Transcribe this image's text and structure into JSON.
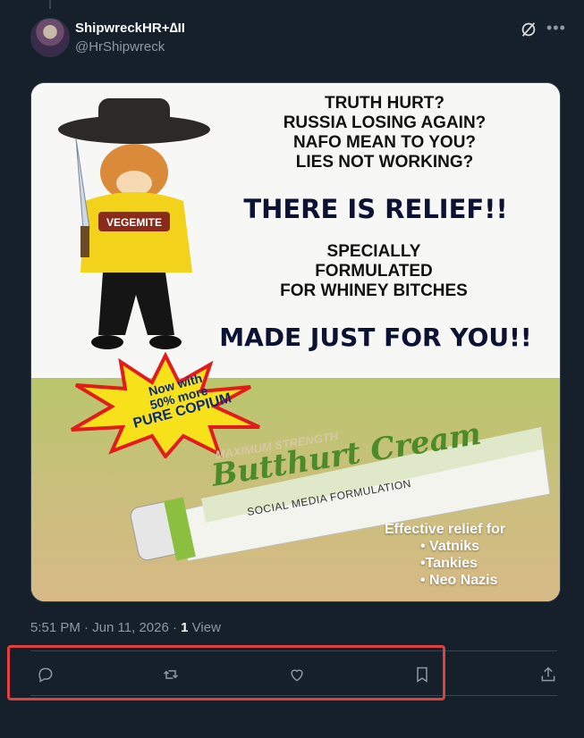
{
  "post": {
    "author_name": "ShipwreckHR+∆II",
    "author_handle": "@HrShipwreck",
    "timestamp": "5:51 PM · Jun 11, 2026 · ",
    "views_count": "1",
    "views_label": " View"
  },
  "image_text": {
    "questions": [
      "TRUTH HURT?",
      "RUSSIA LOSING AGAIN?",
      "NAFO MEAN TO YOU?",
      "LIES NOT WORKING?"
    ],
    "relief": "THERE IS RELIEF!!",
    "special": [
      "SPECIALLY",
      "FORMULATED",
      "FOR WHINEY BITCHES"
    ],
    "made": "MADE JUST FOR YOU!!",
    "badge": [
      "Now with",
      "50% more",
      "PURE COPIUM"
    ],
    "hoodie": "VEGEMITE",
    "tube_strength": "MAXIMUM STRENGTH",
    "tube_brand": "Butthurt Cream",
    "tube_sub": "SOCIAL MEDIA FORMULATION",
    "effective_title": "Effective relief for",
    "effective_items": [
      "• Vatniks",
      "•Tankies",
      "• Neo Nazis"
    ]
  },
  "icons": {
    "reply": "reply-icon",
    "repost": "repost-icon",
    "like": "like-icon",
    "bookmark": "bookmark-icon",
    "share": "share-icon",
    "grok": "grok-icon",
    "more": "more-icon"
  },
  "colors": {
    "background": "#15202b",
    "muted": "#8b98a5",
    "highlight": "#e0403f"
  }
}
